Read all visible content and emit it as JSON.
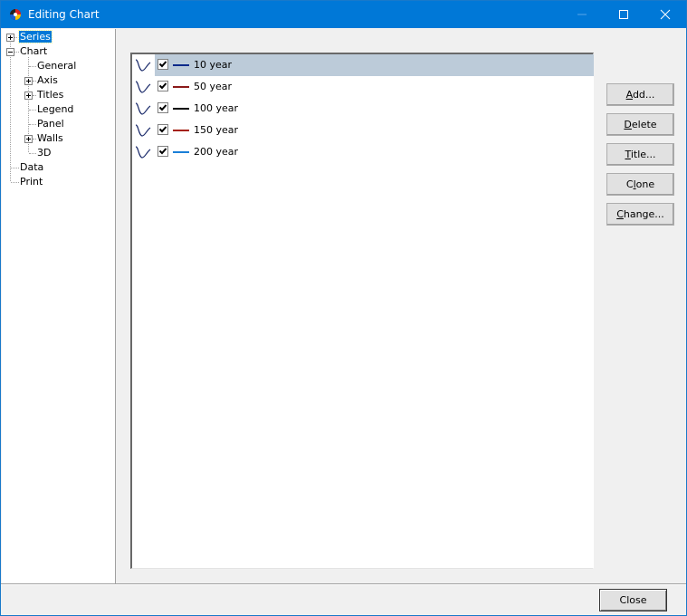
{
  "window": {
    "title": "Editing Chart",
    "controls": {
      "minimize": "minimize",
      "maximize": "maximize",
      "close": "close"
    }
  },
  "tree": {
    "items": [
      {
        "label": "Series",
        "level": 0,
        "expander": "plus",
        "selected": true
      },
      {
        "label": "Chart",
        "level": 0,
        "expander": "minus",
        "selected": false
      },
      {
        "label": "General",
        "level": 1,
        "expander": null
      },
      {
        "label": "Axis",
        "level": 1,
        "expander": "plus"
      },
      {
        "label": "Titles",
        "level": 1,
        "expander": "plus"
      },
      {
        "label": "Legend",
        "level": 1,
        "expander": null
      },
      {
        "label": "Panel",
        "level": 1,
        "expander": null
      },
      {
        "label": "Walls",
        "level": 1,
        "expander": "plus"
      },
      {
        "label": "3D",
        "level": 1,
        "expander": null
      },
      {
        "label": "Data",
        "level": 0,
        "expander": null
      },
      {
        "label": "Print",
        "level": 0,
        "expander": null
      }
    ]
  },
  "series_list": {
    "items": [
      {
        "name": "10 year",
        "checked": true,
        "color": "#0a2a8a",
        "selected": true,
        "icon": "line-series-icon"
      },
      {
        "name": "50 year",
        "checked": true,
        "color": "#8b1a1a",
        "selected": false,
        "icon": "line-series-icon"
      },
      {
        "name": "100 year",
        "checked": true,
        "color": "#000000",
        "selected": false,
        "icon": "line-series-icon"
      },
      {
        "name": "150 year",
        "checked": true,
        "color": "#a52010",
        "selected": false,
        "icon": "line-series-icon"
      },
      {
        "name": "200 year",
        "checked": true,
        "color": "#1a7fd8",
        "selected": false,
        "icon": "line-series-icon"
      }
    ]
  },
  "buttons": {
    "add": {
      "accel": "A",
      "rest": "dd..."
    },
    "delete": {
      "accel": "D",
      "rest": "elete"
    },
    "title": {
      "accel": "T",
      "rest": "itle..."
    },
    "clone": {
      "pre": "C",
      "accel": "l",
      "rest": "one"
    },
    "change": {
      "accel": "C",
      "rest": "hange..."
    },
    "close": "Close"
  },
  "colors": {
    "titlebar": "#0078d7",
    "selection": "#bccbd9",
    "tree_selection": "#0078d7"
  }
}
